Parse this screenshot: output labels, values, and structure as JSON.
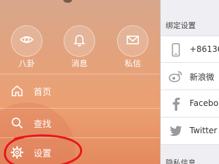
{
  "drawer": {
    "quick_actions": [
      {
        "label": "八卦",
        "icon": "eye-icon"
      },
      {
        "label": "消息",
        "icon": "bell-icon"
      },
      {
        "label": "私信",
        "icon": "envelope-icon"
      }
    ],
    "menu": [
      {
        "label": "首页",
        "icon": "home-icon"
      },
      {
        "label": "查找",
        "icon": "search-icon"
      },
      {
        "label": "设置",
        "icon": "gear-icon"
      }
    ],
    "annotation_color": "#e8161a"
  },
  "settings": {
    "section_binding": "绑定设置",
    "bindings": [
      {
        "text": "+86136",
        "icon": "phone-icon"
      },
      {
        "text": "新浪微",
        "icon": "weibo-icon"
      },
      {
        "text": "Facebo",
        "icon": "facebook-icon"
      },
      {
        "text": "Twitter",
        "icon": "twitter-icon"
      }
    ],
    "section_privacy": "隐私信息"
  }
}
